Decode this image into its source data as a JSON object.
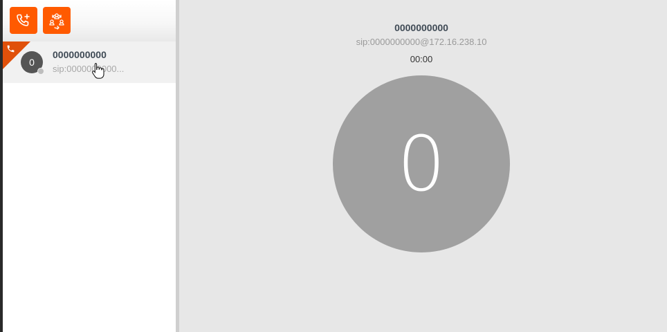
{
  "toolbar": {
    "add_call_icon": "phone-plus-icon",
    "transfer_icon": "contacts-transfer-icon",
    "accent_color": "#ff5a00"
  },
  "contact_list": {
    "items": [
      {
        "name": "0000000000",
        "sip": "sip:0000000000...",
        "avatar_initial": "0",
        "call_indicator_icon": "phone-icon",
        "presence": "offline"
      }
    ]
  },
  "active_call": {
    "name": "0000000000",
    "sip": "sip:0000000000@172.16.238.10",
    "timer": "00:00",
    "avatar_initial": "0"
  },
  "colors": {
    "accent": "#ff5a00",
    "corner_flag": "#e0500a",
    "avatar_small": "#555555",
    "avatar_large": "#a0a0a0"
  }
}
